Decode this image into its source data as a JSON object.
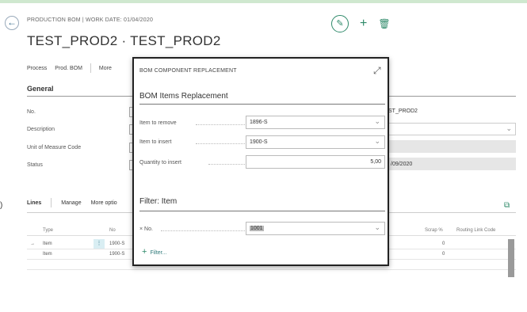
{
  "header": {
    "crumb": "PRODUCTION BOM | WORK DATE: 01/04/2020",
    "title": "TEST_PROD2 · TEST_PROD2",
    "actions": [
      "Process",
      "Prod. BOM",
      "More"
    ]
  },
  "general": {
    "title": "General",
    "fields": [
      {
        "label": "No.",
        "value": "ST_PROD2"
      },
      {
        "label": "Description",
        "value": ""
      },
      {
        "label": "Unit of Measure Code",
        "value": ""
      },
      {
        "label": "Status",
        "value": "/09/2020"
      }
    ]
  },
  "lines": {
    "title": "Lines",
    "actions": [
      "Manage",
      "More optio"
    ],
    "columns": [
      "Type",
      "No",
      "Scrap %",
      "Routing Link Code"
    ],
    "rows": [
      {
        "arrow": "→",
        "type": "Item",
        "no": "1900-S",
        "scrap": "0"
      },
      {
        "arrow": "",
        "type": "Item",
        "no": "1900-S",
        "scrap": "0"
      }
    ],
    "row_menu": "⋮"
  },
  "left_fragment": ")",
  "modal": {
    "title": "BOM COMPONENT REPLACEMENT",
    "section1": "BOM Items Replacement",
    "fields": [
      {
        "label": "Item to remove",
        "value": "1896-S"
      },
      {
        "label": "Item to insert",
        "value": "1900-S"
      },
      {
        "label": "Quantity to insert",
        "value": "5,00"
      }
    ],
    "section2": "Filter: Item",
    "filter": {
      "label": "× No.",
      "value": "1001"
    },
    "add_filter": "Filter..."
  },
  "colors": {
    "accent": "#2f8a6a",
    "frame": "#cfe8cf"
  }
}
